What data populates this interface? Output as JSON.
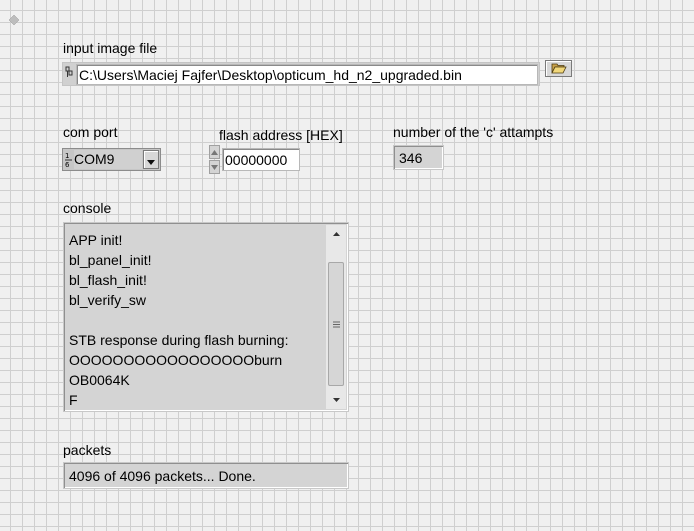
{
  "input_image_file": {
    "label": "input image file",
    "path_icon": "path-type-icon",
    "value": "C:\\Users\\Maciej Fajfer\\Desktop\\opticum_hd_n2_upgraded.bin",
    "browse_icon": "folder-open-icon"
  },
  "com_port": {
    "label": "com port",
    "prefix_icon": "ring-index-icon",
    "value": "COM9",
    "dropdown_icon": "chevron-down-icon"
  },
  "flash_address": {
    "label": "flash address [HEX]",
    "value": "00000000"
  },
  "c_attempts": {
    "label": "number of the 'c' attampts",
    "value": "346"
  },
  "console": {
    "label": "console",
    "lines": [
      "APP  init!",
      "bl_panel_init!",
      "bl_flash_init!",
      "bl_verify_sw",
      "",
      "STB response during flash burning:",
      "OOOOOOOOOOOOOOOOOburn",
      "OB0064K",
      "F"
    ]
  },
  "packets": {
    "label": "packets",
    "value": "4096 of 4096 packets...  Done."
  },
  "colors": {
    "panel_bg": "#f0f0f0",
    "grid": "#cfcfcf",
    "indicator_bg": "#d4d4d4"
  }
}
